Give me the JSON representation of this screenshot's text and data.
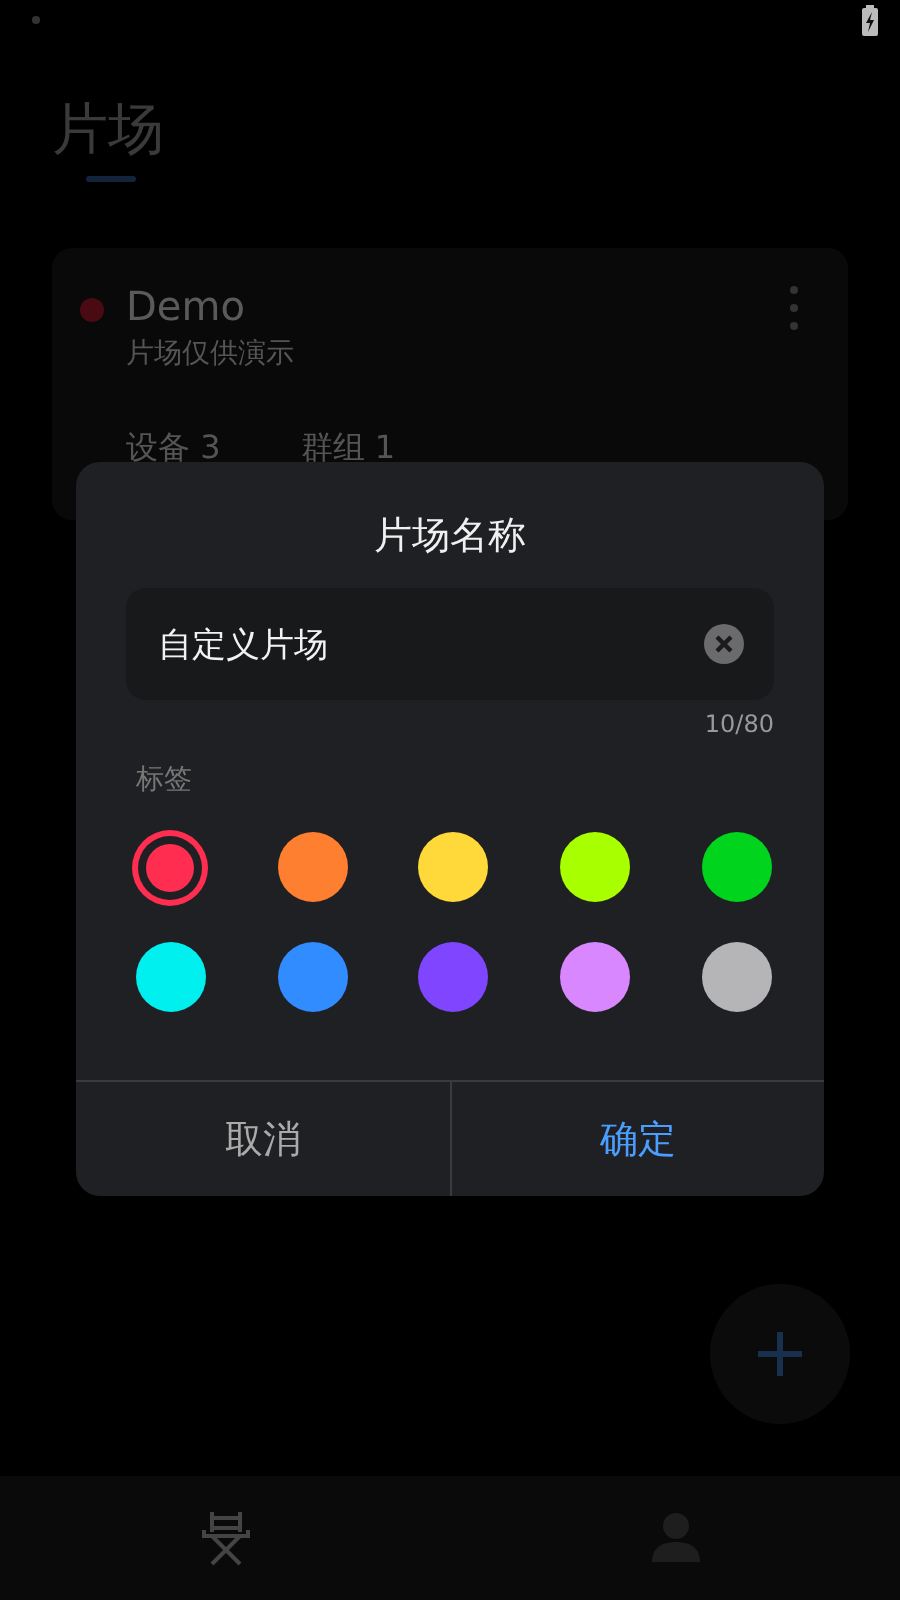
{
  "page": {
    "title": "片场"
  },
  "card": {
    "color": "#4a0a12",
    "name": "Demo",
    "description": "片场仅供演示",
    "stats": [
      {
        "label": "设备 3"
      },
      {
        "label": "群组 1"
      }
    ]
  },
  "dialog": {
    "title": "片场名称",
    "name_field": {
      "value": "自定义片场"
    },
    "counter": "10/80",
    "tags_label": "标签",
    "colors": [
      {
        "color": "#ff2d4f",
        "selected": true
      },
      {
        "color": "#ff7f30",
        "selected": false
      },
      {
        "color": "#ffd93a",
        "selected": false
      },
      {
        "color": "#a8ff00",
        "selected": false
      },
      {
        "color": "#00d41c",
        "selected": false
      },
      {
        "color": "#00f0f0",
        "selected": false
      },
      {
        "color": "#318cff",
        "selected": false
      },
      {
        "color": "#8046ff",
        "selected": false
      },
      {
        "color": "#d887ff",
        "selected": false
      },
      {
        "color": "#b5b5b8",
        "selected": false
      }
    ],
    "buttons": [
      {
        "label": "取消",
        "kind": "cancel"
      },
      {
        "label": "确定",
        "kind": "confirm"
      }
    ]
  },
  "bottom_nav": [
    {
      "kind": "director",
      "selected": true
    },
    {
      "kind": "profile",
      "selected": false
    }
  ]
}
